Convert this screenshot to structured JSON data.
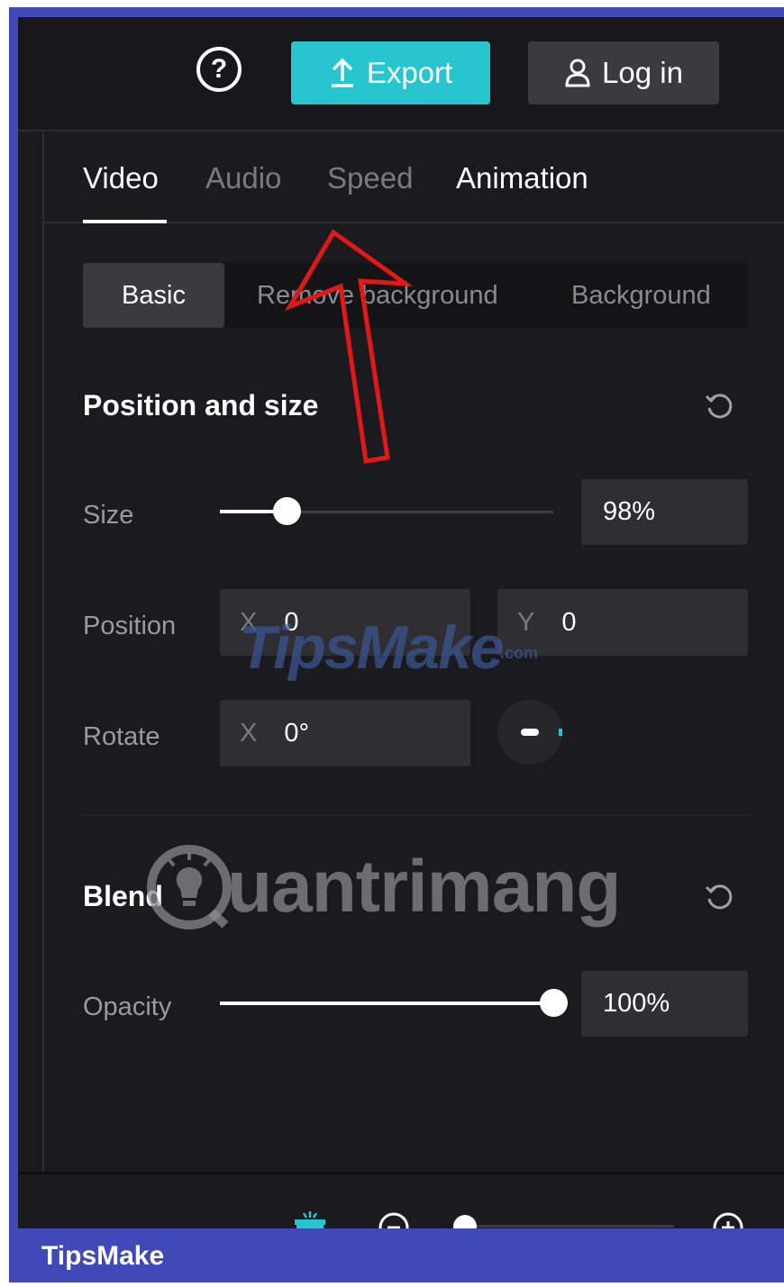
{
  "topbar": {
    "help_label": "?",
    "export_label": "Export",
    "login_label": "Log in"
  },
  "tabs": [
    {
      "label": "Video",
      "active": true
    },
    {
      "label": "Audio",
      "active": false
    },
    {
      "label": "Speed",
      "active": false
    },
    {
      "label": "Animation",
      "active": false
    }
  ],
  "subtabs": [
    {
      "label": "Basic",
      "active": true
    },
    {
      "label": "Remove background",
      "active": false
    },
    {
      "label": "Background",
      "active": false
    }
  ],
  "position_size": {
    "title": "Position and size",
    "size": {
      "label": "Size",
      "value": "98%",
      "slider_fraction": 0.2
    },
    "position": {
      "label": "Position",
      "x_axis": "X",
      "x_value": "0",
      "y_axis": "Y",
      "y_value": "0"
    },
    "rotate": {
      "label": "Rotate",
      "axis": "X",
      "value": "0°"
    }
  },
  "blend": {
    "title": "Blend",
    "opacity": {
      "label": "Opacity",
      "value": "100%",
      "slider_fraction": 1.0
    }
  },
  "footer": {
    "brand": "TipsMake"
  },
  "watermarks": {
    "tipsmake": "TipsMake",
    "tipsmake_suffix": ".com",
    "quantrimang": "uantrimang"
  },
  "colors": {
    "accent": "#27c6cf",
    "annotation": "#e01818",
    "frame": "#4149b8"
  }
}
